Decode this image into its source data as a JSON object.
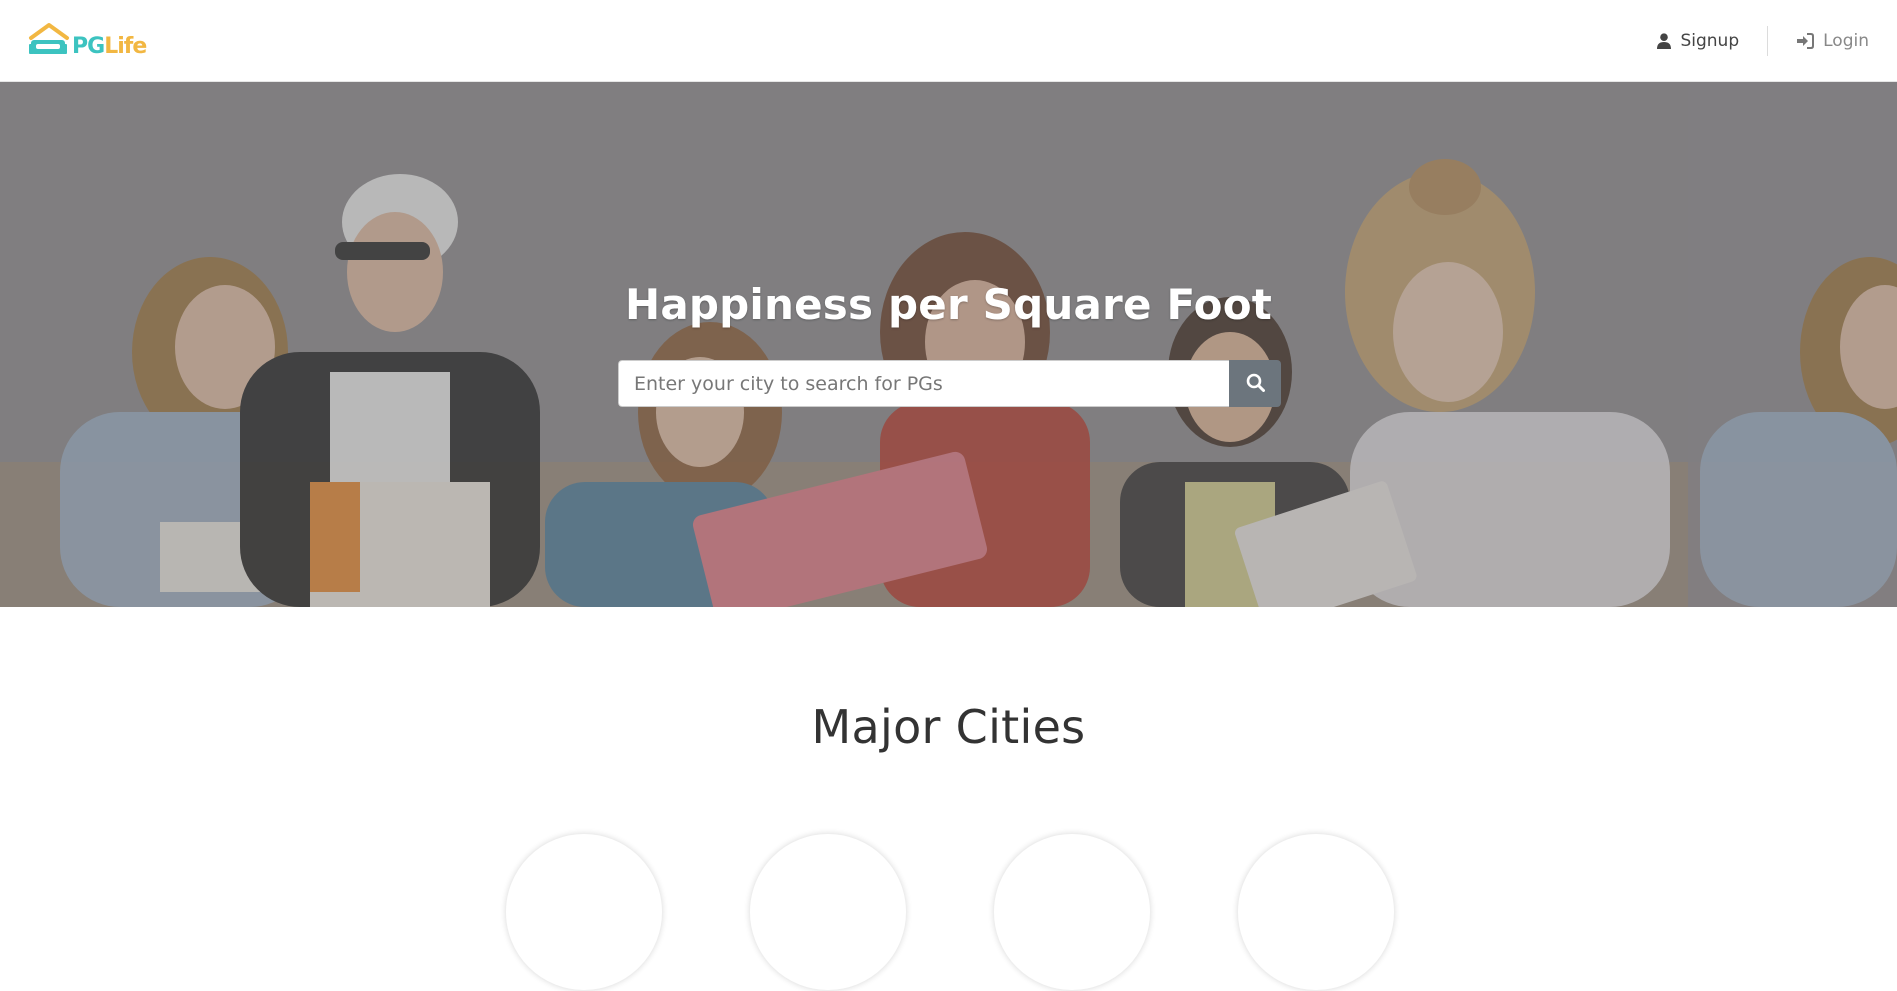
{
  "brand": {
    "logo_pg": "PG",
    "logo_life": "Life",
    "icon": "house-logo-icon"
  },
  "nav": {
    "signup_label": "Signup",
    "signup_icon": "user-icon",
    "login_label": "Login",
    "login_icon": "sign-in-icon"
  },
  "hero": {
    "title": "Happiness per Square Foot",
    "search_placeholder": "Enter your city to search for PGs",
    "search_value": "",
    "search_icon": "search-icon"
  },
  "major_cities": {
    "title": "Major Cities",
    "cities": [
      {
        "name": "",
        "icon": "city-icon"
      },
      {
        "name": "",
        "icon": "city-icon"
      },
      {
        "name": "",
        "icon": "city-icon"
      },
      {
        "name": "",
        "icon": "city-icon"
      }
    ]
  },
  "colors": {
    "brand_teal": "#3cc3c0",
    "brand_yellow": "#f2b742",
    "search_button": "#6c757d",
    "hero_overlay": "#8d8b8e"
  }
}
